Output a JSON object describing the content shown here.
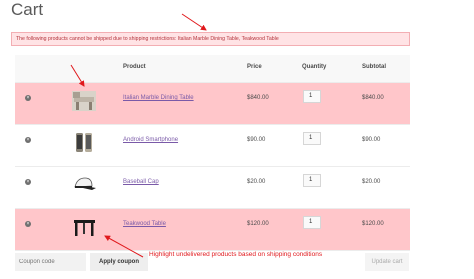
{
  "page": {
    "title": "Cart"
  },
  "notice": {
    "text": "The following products cannot be shipped due to shipping restrictions: Italian Marble Dining Table, Teakwood Table"
  },
  "table": {
    "headers": {
      "product": "Product",
      "price": "Price",
      "quantity": "Quantity",
      "subtotal": "Subtotal"
    },
    "rows": [
      {
        "name": "Italian Marble Dining Table",
        "price": "$840.00",
        "quantity": "1",
        "subtotal": "$840.00",
        "restricted": true,
        "icon": "marble-table-image"
      },
      {
        "name": "Android Smartphone",
        "price": "$90.00",
        "quantity": "1",
        "subtotal": "$90.00",
        "restricted": false,
        "icon": "smartphone-image"
      },
      {
        "name": "Baseball Cap",
        "price": "$20.00",
        "quantity": "1",
        "subtotal": "$20.00",
        "restricted": false,
        "icon": "cap-image"
      },
      {
        "name": "Teakwood Table",
        "price": "$120.00",
        "quantity": "1",
        "subtotal": "$120.00",
        "restricted": true,
        "icon": "teakwood-table-image"
      }
    ],
    "remove_glyph": "×"
  },
  "coupon": {
    "placeholder": "Coupon code",
    "apply_label": "Apply coupon",
    "update_label": "Update cart"
  },
  "annotation": {
    "text": "Highlight undelivered products based on shipping conditions"
  },
  "colors": {
    "restricted_row": "#ffc6ca",
    "notice_bg": "#ffe3e5",
    "annotation": "#e0181c",
    "link": "#7a5aa8"
  }
}
